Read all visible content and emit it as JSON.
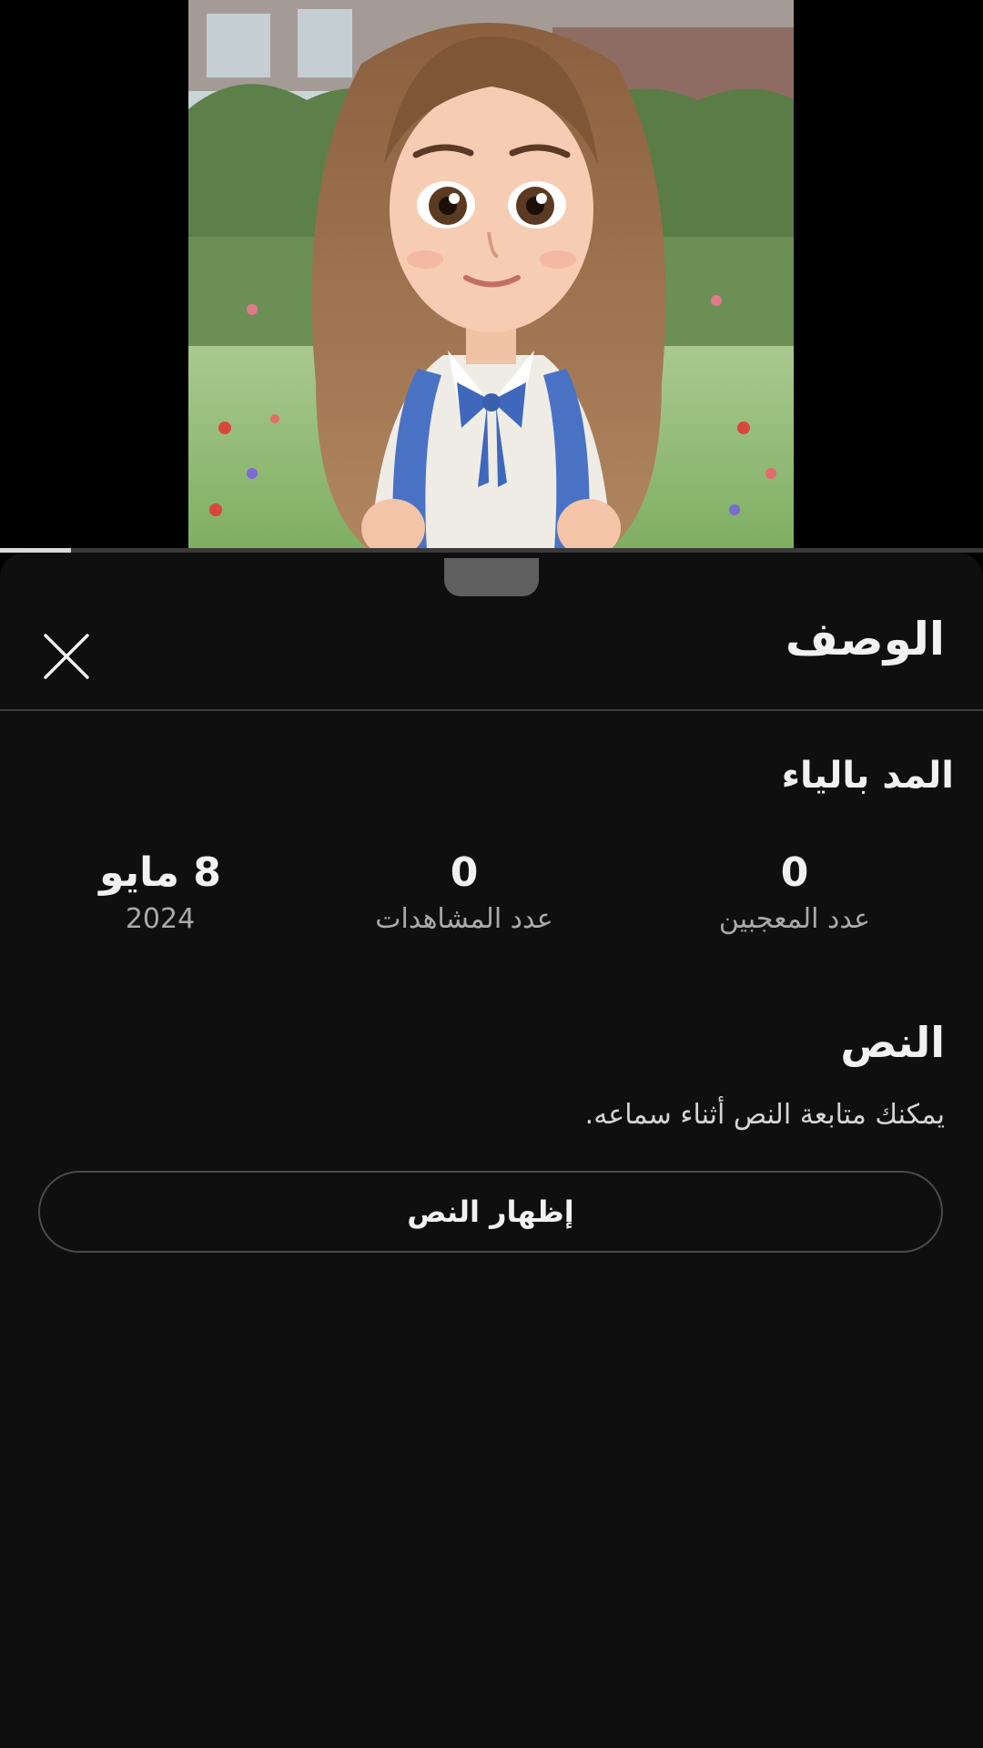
{
  "video": {
    "thumbnail_alt": "cartoon girl with long brown hair and blue backpack",
    "progress_fraction": 0.072
  },
  "sheet": {
    "title": "الوصف",
    "close_icon": "close-icon"
  },
  "details": {
    "video_title": "المد بالياء",
    "stats": {
      "likes_value": "0",
      "likes_label": "عدد المعجبين",
      "views_value": "0",
      "views_label": "عدد المشاهدات",
      "date_value": "8 مايو",
      "date_year": "2024"
    }
  },
  "transcript": {
    "heading": "النص",
    "description": "يمكنك متابعة النص أثناء سماعه.",
    "button_label": "إظهار النص"
  },
  "colors": {
    "sheet_bg": "#0f0f0f",
    "text_primary": "#f1f1f1",
    "text_secondary": "#aaaaaa",
    "backpack_blue": "#4a72c4"
  }
}
